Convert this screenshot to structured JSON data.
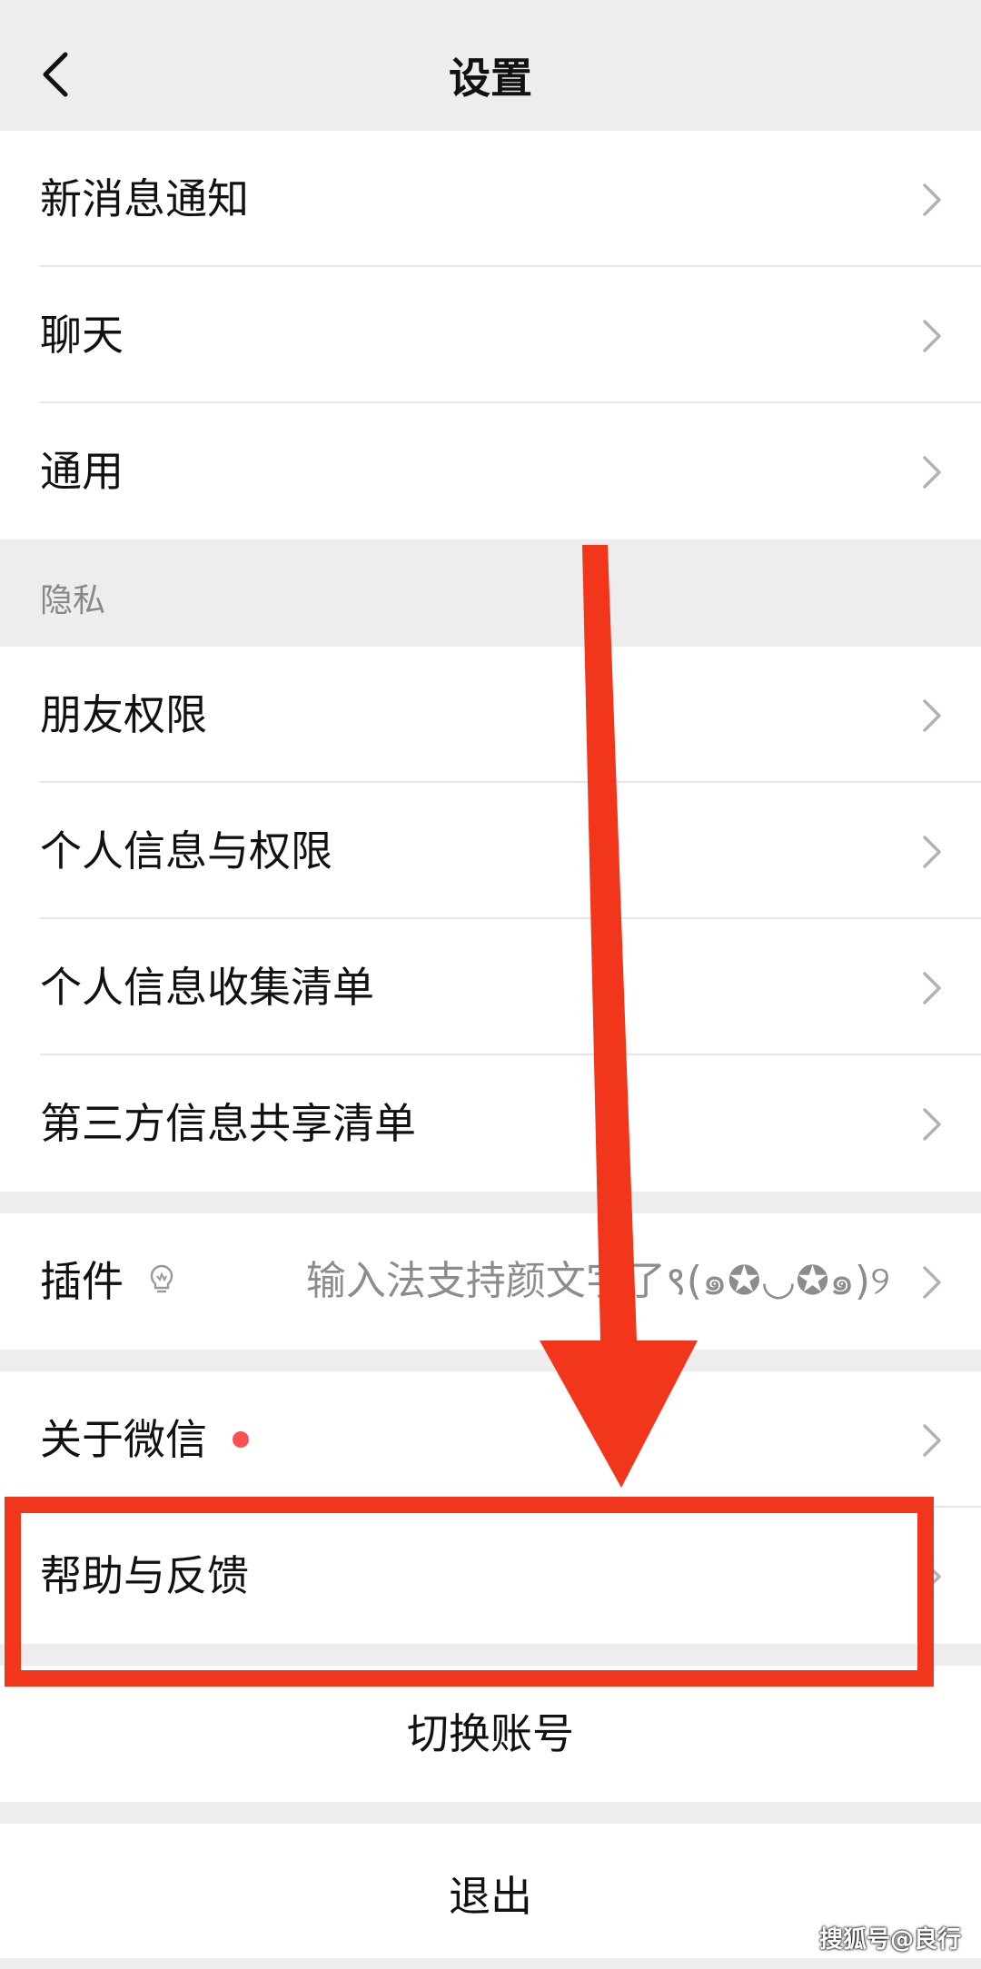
{
  "header": {
    "title": "设置"
  },
  "group1": [
    {
      "label": "新消息通知"
    },
    {
      "label": "聊天"
    },
    {
      "label": "通用"
    }
  ],
  "privacy_section": {
    "label": "隐私"
  },
  "group2": [
    {
      "label": "朋友权限"
    },
    {
      "label": "个人信息与权限"
    },
    {
      "label": "个人信息收集清单"
    },
    {
      "label": "第三方信息共享清单"
    }
  ],
  "plugins": {
    "label": "插件",
    "value": "输入法支持颜文字了९(๑✪◡✪๑)୨",
    "icon": "lightbulb-icon"
  },
  "about": {
    "label": "关于微信",
    "badge_color": "#fa5151"
  },
  "help": {
    "label": "帮助与反馈"
  },
  "actions": {
    "switch_account": "切换账号",
    "logout": "退出"
  },
  "annotation": {
    "arrow_color": "#f2361b",
    "box_color": "#f2361b"
  },
  "watermark": {
    "text": "搜狐号@良行"
  }
}
